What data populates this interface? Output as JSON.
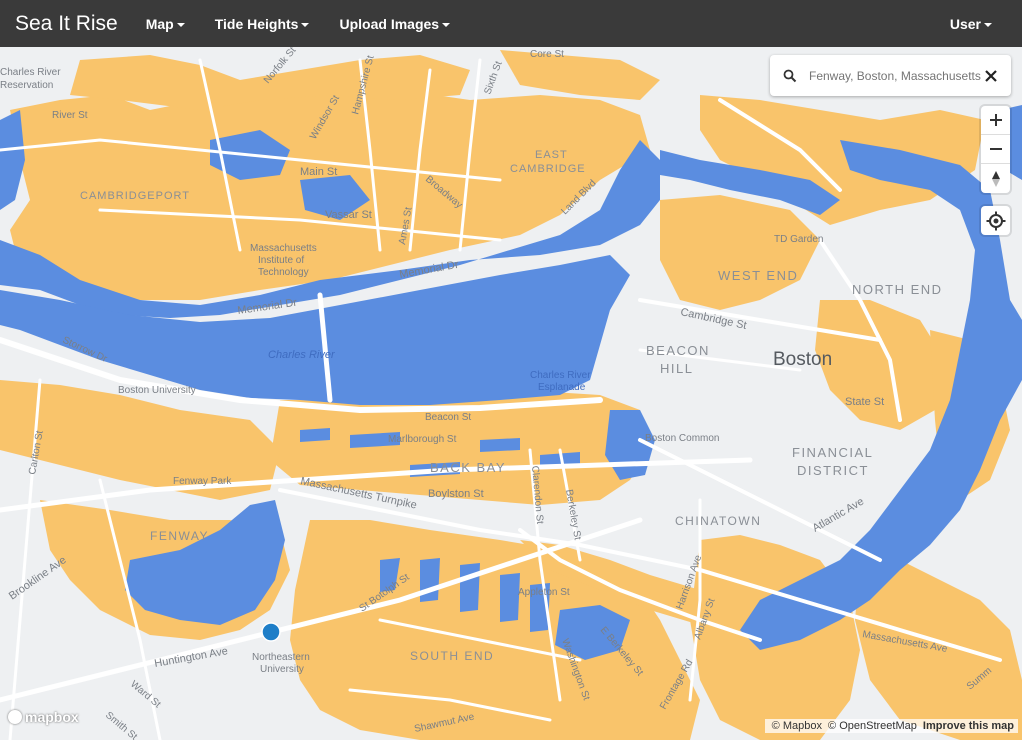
{
  "navbar": {
    "brand": "Sea It Rise",
    "items": [
      "Map",
      "Tide Heights",
      "Upload Images"
    ],
    "user": "User"
  },
  "search": {
    "value": "",
    "placeholder": "Fenway, Boston, Massachusetts"
  },
  "controls": {
    "zoom_in": "+",
    "zoom_out": "−"
  },
  "colors": {
    "water": "#5b8de0",
    "flood": "#f9c46b",
    "land": "#eef0f2",
    "navbar": "#3a3a3a",
    "marker": "#1e7ec8"
  },
  "map_labels": {
    "districts": {
      "cambridgeport": "CAMBRIDGEPORT",
      "east": "EAST",
      "cambridge": "CAMBRIDGE",
      "west_end": "WEST END",
      "north_end": "NORTH END",
      "beacon": "BEACON",
      "hill": "HILL",
      "back_bay": "BACK BAY",
      "fenway": "FENWAY",
      "chinatown": "CHINATOWN",
      "financial": "FINANCIAL",
      "district": "DISTRICT",
      "south_end": "SOUTH END"
    },
    "city": "Boston",
    "places": {
      "charles_river_res_1": "Charles River",
      "charles_river_res_2": "Reservation",
      "mit_1": "Massachusetts",
      "mit_2": "Institute of",
      "mit_3": "Technology",
      "td_garden": "TD Garden",
      "charles_river": "Charles River",
      "esplanade_1": "Charles River",
      "esplanade_2": "Esplanade",
      "boston_university": "Boston University",
      "boston_common": "Boston Common",
      "fenway_park": "Fenway Park",
      "northeastern_1": "Northeastern",
      "northeastern_2": "University"
    },
    "streets": {
      "river_st": "River St",
      "main_st": "Main St",
      "vassar_st": "Vassar St",
      "memorial_dr_1": "Memorial Dr",
      "memorial_dr_2": "Memorial Dr",
      "land_blvd": "Land Blvd",
      "sixth_st": "Sixth St",
      "storrow_dr": "Storrow Dr",
      "cambridge_st": "Cambridge St",
      "state_st": "State St",
      "beacon_st": "Beacon St",
      "marlborough_st": "Marlborough St",
      "boylston_st": "Boylston St",
      "mass_tpk": "Massachusetts Turnpike",
      "clarendon_st": "Clarendon St",
      "berkeley_st": "Berkeley St",
      "atlantic_ave": "Atlantic Ave",
      "harrison_ave": "Harrison Ave",
      "albany_st": "Albany St",
      "e_berkeley_st": "E Berkeley St",
      "frontage_rd": "Frontage Rd",
      "mass_ave": "Massachusetts Ave",
      "st_botolph_st": "St Botolph St",
      "appleton_st": "Appleton St",
      "huntington_ave": "Huntington Ave",
      "brookline_ave": "Brookline Ave",
      "carlton_st": "Carlton St",
      "shawmut_ave": "Shawmut Ave",
      "washington_st": "Washington St",
      "ward_st": "Ward St",
      "smith_st": "Smith St",
      "norfolk_st": "Norfolk St",
      "windsor_st": "Windsor St",
      "hampshire_st": "Hampshire St",
      "broadway": "Broadway",
      "ames_st": "Ames St",
      "core_st": "Core St",
      "summer_st": "Summ"
    }
  },
  "logo": "mapbox",
  "attribution": {
    "mapbox": "© Mapbox",
    "osm": "© OpenStreetMap",
    "improve": "Improve this map"
  }
}
